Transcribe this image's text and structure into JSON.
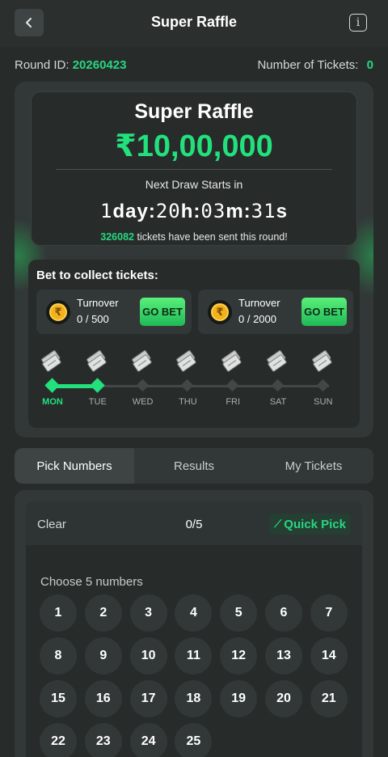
{
  "header": {
    "title": "Super Raffle",
    "back_icon": "chevron-left-icon",
    "info_icon": "info-icon"
  },
  "round": {
    "id_label": "Round ID:",
    "id_value": "20260423",
    "tickets_label": "Number of Tickets:",
    "tickets_value": "0"
  },
  "prize": {
    "title": "Super Raffle",
    "amount": "₹10,00,000",
    "next_draw_label": "Next Draw Starts in",
    "countdown": {
      "days": "1",
      "days_unit": "day:",
      "hours": "20",
      "hours_unit": "h:",
      "minutes": "03",
      "minutes_unit": "m:",
      "seconds": "31",
      "seconds_unit": "s"
    },
    "sent_count": "326082",
    "sent_text": " tickets have been sent this round!"
  },
  "bet": {
    "title": "Bet to collect tickets:",
    "turnovers": [
      {
        "label": "Turnover",
        "value": "0 / 500",
        "button": "GO BET"
      },
      {
        "label": "Turnover",
        "value": "0 / 2000",
        "button": "GO BET"
      }
    ]
  },
  "week": {
    "days": [
      "MON",
      "TUE",
      "WED",
      "THU",
      "FRI",
      "SAT",
      "SUN"
    ],
    "progress_days": 2
  },
  "tabs": [
    "Pick Numbers",
    "Results",
    "My Tickets"
  ],
  "picker": {
    "clear_label": "Clear",
    "count": "0/5",
    "quick_pick_label": "Quick Pick",
    "choose_label": "Choose 5 numbers",
    "numbers": [
      "1",
      "2",
      "3",
      "4",
      "5",
      "6",
      "7",
      "8",
      "9",
      "10",
      "11",
      "12",
      "13",
      "14",
      "15",
      "16",
      "17",
      "18",
      "19",
      "20",
      "21",
      "22",
      "23",
      "24",
      "25"
    ]
  },
  "colors": {
    "accent_green": "#22e07c",
    "background": "#272c2b",
    "coin_gold": "#f3b21b"
  }
}
